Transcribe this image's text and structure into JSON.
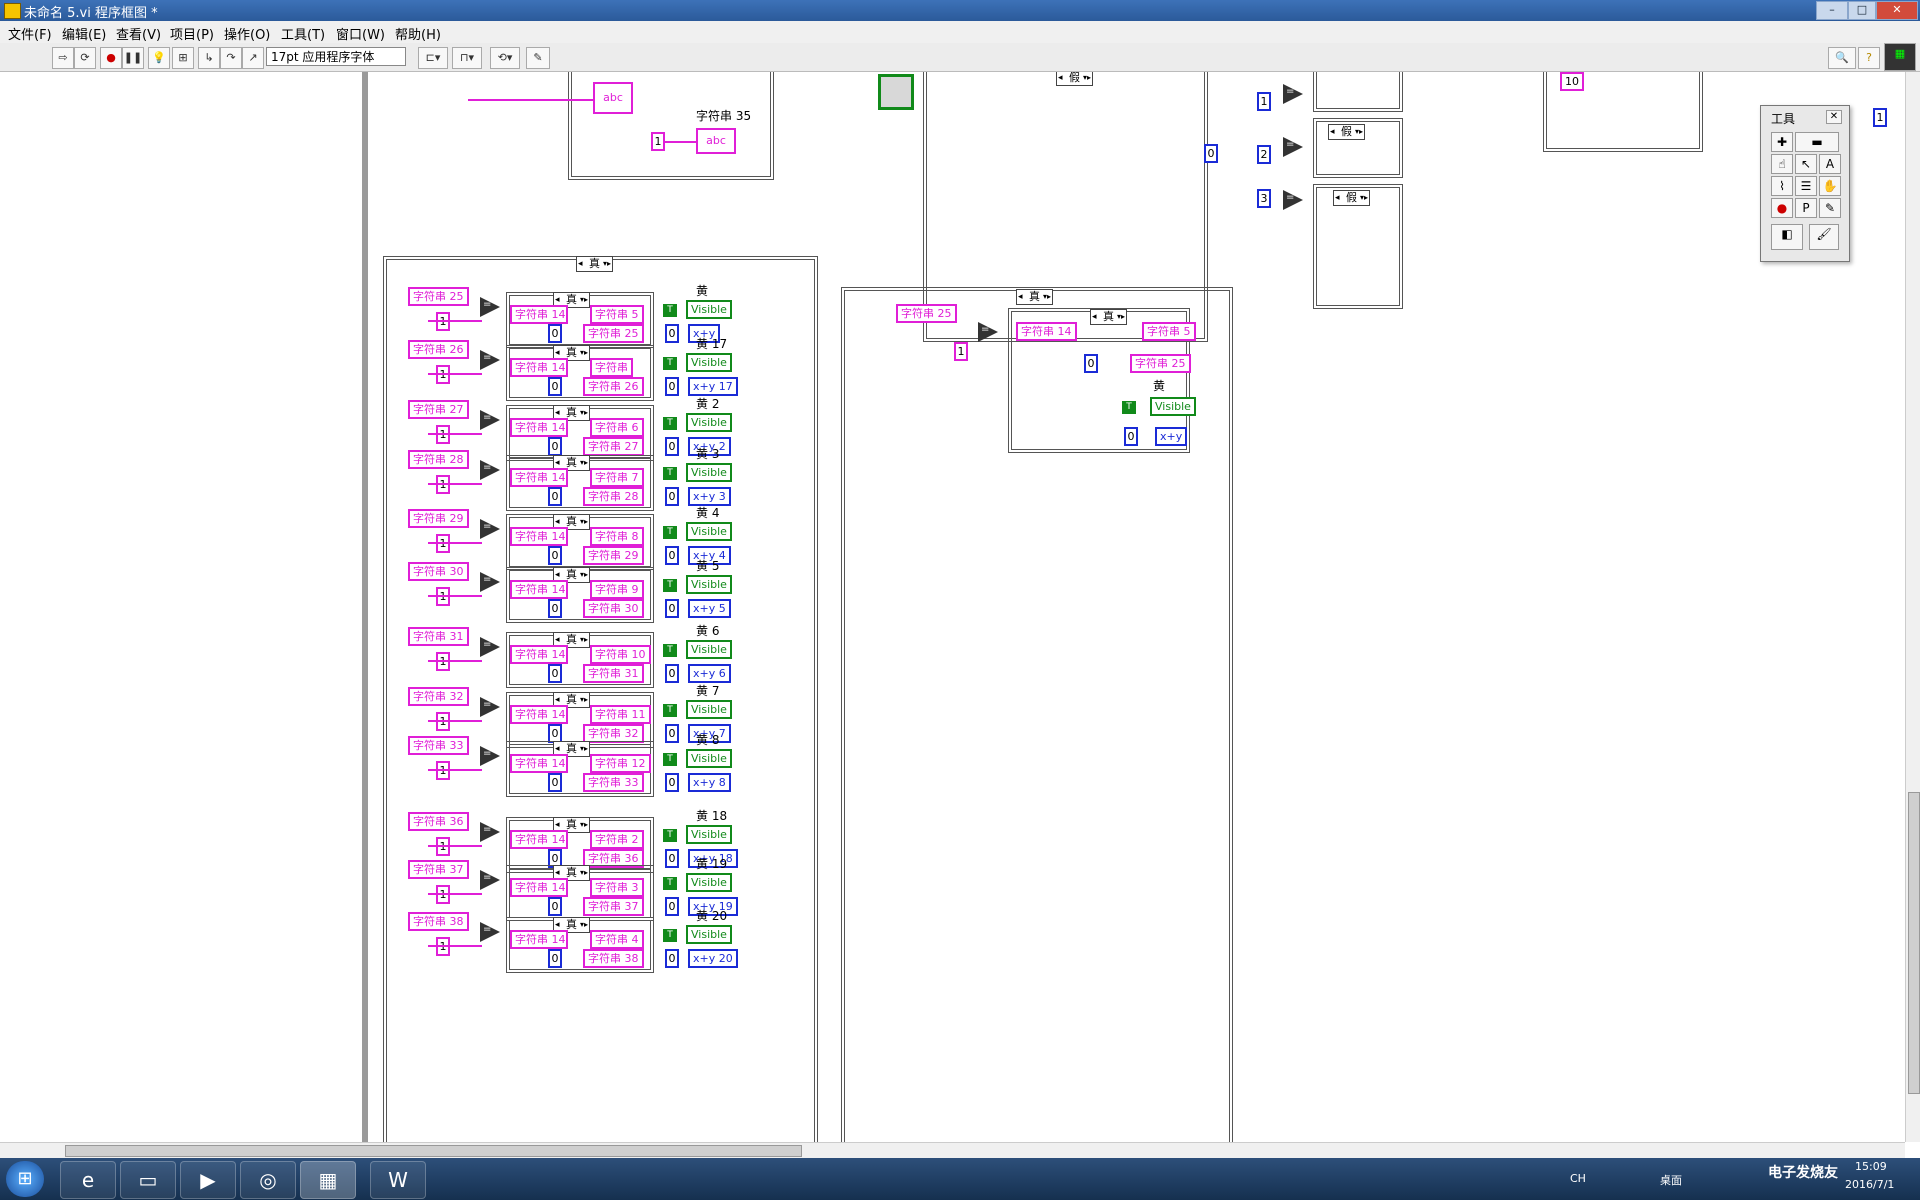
{
  "window": {
    "title": "未命名 5.vi 程序框图 *"
  },
  "menu": [
    "文件(F)",
    "编辑(E)",
    "查看(V)",
    "项目(P)",
    "操作(O)",
    "工具(T)",
    "窗口(W)",
    "帮助(H)"
  ],
  "toolbar": {
    "font": "17pt 应用程序字体"
  },
  "palette": {
    "title": "工具"
  },
  "diagram": {
    "case_true": "真",
    "case_false": "假",
    "top_label": "字符串 35",
    "top_const": "1",
    "num_const_0": "0",
    "num_const_10": "10",
    "num_const_1": "1",
    "num_const_2": "2",
    "num_const_3": "3",
    "rows": [
      {
        "str": "字符串 25",
        "inner": "字符串 5",
        "out": "字符串 25",
        "light": "黄",
        "xy": "x+y"
      },
      {
        "str": "字符串 26",
        "inner": "字符串",
        "out": "字符串 26",
        "light": "黄 17",
        "xy": "x+y 17"
      },
      {
        "str": "字符串 27",
        "inner": "字符串 6",
        "out": "字符串 27",
        "light": "黄 2",
        "xy": "x+y 2"
      },
      {
        "str": "字符串 28",
        "inner": "字符串 7",
        "out": "字符串 28",
        "light": "黄 3",
        "xy": "x+y 3"
      },
      {
        "str": "字符串 29",
        "inner": "字符串 8",
        "out": "字符串 29",
        "light": "黄 4",
        "xy": "x+y 4"
      },
      {
        "str": "字符串 30",
        "inner": "字符串 9",
        "out": "字符串 30",
        "light": "黄 5",
        "xy": "x+y 5"
      },
      {
        "str": "字符串 31",
        "inner": "字符串 10",
        "out": "字符串 31",
        "light": "黄 6",
        "xy": "x+y 6"
      },
      {
        "str": "字符串 32",
        "inner": "字符串 11",
        "out": "字符串 32",
        "light": "黄 7",
        "xy": "x+y 7"
      },
      {
        "str": "字符串 33",
        "inner": "字符串 12",
        "out": "字符串 33",
        "light": "黄 8",
        "xy": "x+y 8"
      },
      {
        "str": "字符串 36",
        "inner": "字符串 2",
        "out": "字符串 36",
        "light": "黄 18",
        "xy": "x+y 18"
      },
      {
        "str": "字符串 37",
        "inner": "字符串 3",
        "out": "字符串 37",
        "light": "黄 19",
        "xy": "x+y 19"
      },
      {
        "str": "字符串 38",
        "inner": "字符串 4",
        "out": "字符串 38",
        "light": "黄 20",
        "xy": "x+y 20"
      }
    ],
    "right": {
      "str": "字符串 25",
      "inner_left": "字符串 14",
      "inner_right": "字符串 5",
      "out": "字符串 25",
      "light": "黄",
      "xy": "x+y"
    },
    "visible": "Visible",
    "true_const": "T",
    "eq": "=",
    "str_const": "abc"
  },
  "taskbar": {
    "lang": "CH",
    "desktop": "桌面",
    "brand": "电子发烧友",
    "time": "15:09",
    "date": "2016/7/1"
  }
}
